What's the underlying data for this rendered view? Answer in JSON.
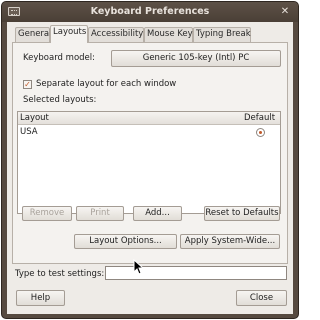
{
  "window": {
    "title": "Keyboard Preferences"
  },
  "tabs": [
    {
      "label": "General",
      "active": false
    },
    {
      "label": "Layouts",
      "active": true
    },
    {
      "label": "Accessibility",
      "active": false
    },
    {
      "label": "Mouse Keys",
      "active": false
    },
    {
      "label": "Typing Break",
      "active": false
    }
  ],
  "layouts_tab": {
    "model_label": "Keyboard model:",
    "model_value": "Generic 105-key (Intl) PC",
    "separate_layout_label": "Separate layout for each window",
    "separate_layout_checked": true,
    "selected_layouts_label": "Selected layouts:",
    "list": {
      "columns": [
        "Layout",
        "Default"
      ],
      "rows": [
        {
          "layout": "USA",
          "default": true
        }
      ]
    },
    "buttons": {
      "remove": "Remove",
      "print": "Print",
      "add": "Add...",
      "reset": "Reset to Defaults",
      "layout_options": "Layout Options...",
      "apply_system_wide": "Apply System-Wide..."
    }
  },
  "test": {
    "label": "Type to test settings:",
    "value": ""
  },
  "footer": {
    "help": "Help",
    "close": "Close"
  },
  "colors": {
    "window_frame": "#564a40",
    "content_bg": "#eeebe7",
    "accent": "#c0592a"
  }
}
